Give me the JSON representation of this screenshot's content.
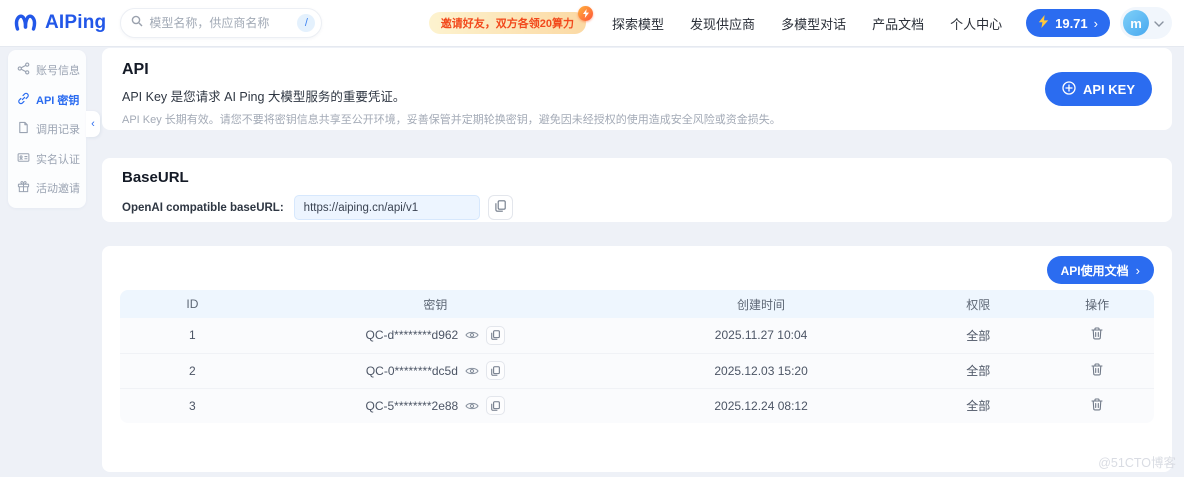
{
  "colors": {
    "primary": "#2b6cf0",
    "logo_blue": "#2257e8",
    "promo_text": "#f2491c",
    "table_header_bg": "#eef6fe"
  },
  "header": {
    "logo_text": "AIPing",
    "search_placeholder": "模型名称，供应商名称",
    "search_shortcut": "/",
    "promo_text": "邀请好友，双方各领20算力",
    "nav_items": [
      "探索模型",
      "发现供应商",
      "多模型对话",
      "产品文档",
      "个人中心"
    ],
    "credits": "19.71",
    "credits_arrow": "›",
    "avatar_initial": "m"
  },
  "sidebar": {
    "items": [
      {
        "label": "账号信息"
      },
      {
        "label": "API 密钥"
      },
      {
        "label": "调用记录"
      },
      {
        "label": "实名认证"
      },
      {
        "label": "活动邀请"
      }
    ],
    "collapse_arrow": "‹"
  },
  "api_card": {
    "title": "API",
    "description": "API Key 是您请求 AI Ping 大模型服务的重要凭证。",
    "note": "API Key 长期有效。请您不要将密钥信息共享至公开环境，妥善保管并定期轮换密钥，避免因未经授权的使用造成安全风险或资金损失。",
    "create_button": "API KEY"
  },
  "baseurl_card": {
    "title": "BaseURL",
    "label": "OpenAI compatible baseURL:",
    "url": "https://aiping.cn/api/v1"
  },
  "keys_card": {
    "docs_button": "API使用文档",
    "docs_arrow": "›",
    "table": {
      "headers": [
        "ID",
        "密钥",
        "创建时间",
        "权限",
        "操作"
      ],
      "rows": [
        {
          "id": "1",
          "key": "QC-d********d962",
          "created": "2025.11.27 10:04",
          "permission": "全部"
        },
        {
          "id": "2",
          "key": "QC-0********dc5d",
          "created": "2025.12.03 15:20",
          "permission": "全部"
        },
        {
          "id": "3",
          "key": "QC-5********2e88",
          "created": "2025.12.24 08:12",
          "permission": "全部"
        }
      ]
    }
  },
  "watermark": "@51CTO博客"
}
